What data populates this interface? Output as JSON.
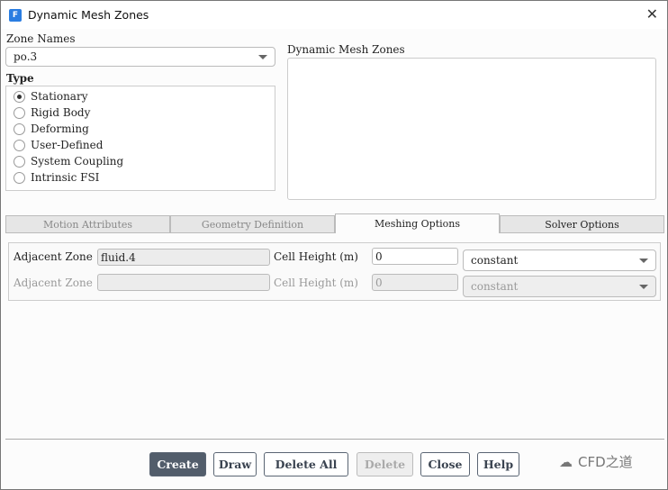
{
  "window": {
    "title": "Dynamic Mesh Zones",
    "app_icon": "F",
    "close": "✕"
  },
  "zone_names": {
    "label": "Zone Names",
    "value": "po.3"
  },
  "dynamic_zones": {
    "label": "Dynamic Mesh Zones",
    "items": []
  },
  "type": {
    "label": "Type",
    "options": [
      {
        "label": "Stationary",
        "selected": true
      },
      {
        "label": "Rigid Body",
        "selected": false
      },
      {
        "label": "Deforming",
        "selected": false
      },
      {
        "label": "User-Defined",
        "selected": false
      },
      {
        "label": "System Coupling",
        "selected": false
      },
      {
        "label": "Intrinsic FSI",
        "selected": false
      }
    ]
  },
  "tabs": [
    "Motion Attributes",
    "Geometry Definition",
    "Meshing Options",
    "Solver Options"
  ],
  "active_tab": "Meshing Options",
  "meshing": {
    "rows": [
      {
        "adj_label": "Adjacent Zone",
        "adj_value": "fluid.4",
        "cell_label": "Cell Height (m)",
        "cell_value": "0",
        "method": "constant",
        "enabled": true
      },
      {
        "adj_label": "Adjacent Zone",
        "adj_value": "",
        "cell_label": "Cell Height (m)",
        "cell_value": "0",
        "method": "constant",
        "enabled": false
      }
    ]
  },
  "buttons": {
    "create": "Create",
    "draw": "Draw",
    "delete_all": "Delete All",
    "delete": "Delete",
    "close": "Close",
    "help": "Help"
  },
  "watermark": "CFD之道"
}
